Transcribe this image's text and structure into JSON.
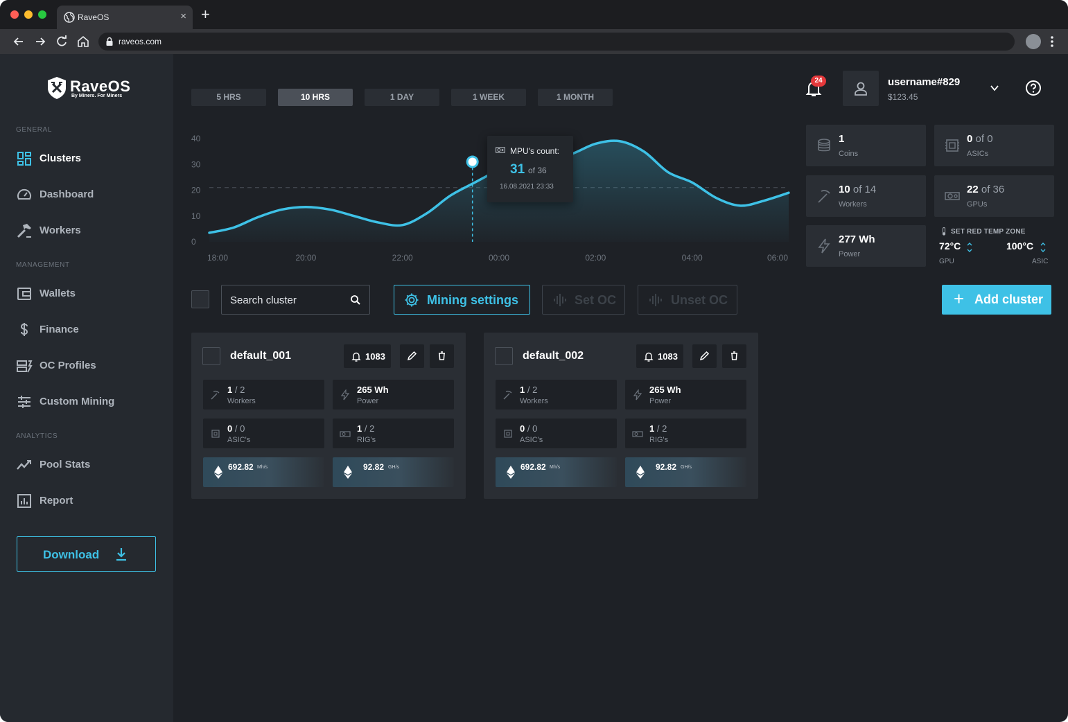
{
  "browser": {
    "tab_title": "RaveOS",
    "tab_close": "×",
    "new_tab": "+",
    "url": "raveos.com"
  },
  "brand": {
    "name": "RaveOS",
    "tagline": "By Miners. For Miners"
  },
  "sidebar": {
    "sections": [
      {
        "label": "GENERAL",
        "items": [
          {
            "label": "Clusters",
            "icon": "grid-icon",
            "active": true
          },
          {
            "label": "Dashboard",
            "icon": "gauge-icon"
          },
          {
            "label": "Workers",
            "icon": "hammer-icon"
          }
        ]
      },
      {
        "label": "MANAGEMENT",
        "items": [
          {
            "label": "Wallets",
            "icon": "wallet-icon"
          },
          {
            "label": "Finance",
            "icon": "dollar-icon"
          },
          {
            "label": "OC Profiles",
            "icon": "oc-icon"
          },
          {
            "label": "Custom Mining",
            "icon": "sliders-icon"
          }
        ]
      },
      {
        "label": "ANALYTICS",
        "items": [
          {
            "label": "Pool Stats",
            "icon": "trend-icon"
          },
          {
            "label": "Report",
            "icon": "report-icon"
          }
        ]
      }
    ],
    "download_label": "Download"
  },
  "range_tabs": [
    {
      "label": "5 HRS",
      "active": false
    },
    {
      "label": "10 HRS",
      "active": true
    },
    {
      "label": "1 DAY",
      "active": false
    },
    {
      "label": "1 WEEK",
      "active": false
    },
    {
      "label": "1 MONTH",
      "active": false
    }
  ],
  "chart_data": {
    "type": "area",
    "x_ticks": [
      "18:00",
      "20:00",
      "22:00",
      "00:00",
      "02:00",
      "04:00",
      "06:00"
    ],
    "y_ticks": [
      0,
      10,
      20,
      30,
      40
    ],
    "ylim": [
      0,
      40
    ],
    "xlim": [
      0,
      12
    ],
    "threshold": 21,
    "x": [
      0,
      0.5,
      1,
      1.5,
      2,
      2.5,
      3,
      3.5,
      4,
      4.5,
      5,
      5.5,
      6,
      6.5,
      7,
      7.5,
      8,
      8.5,
      9,
      9.5,
      10,
      10.5,
      11,
      11.5,
      12
    ],
    "y": [
      3.5,
      5.5,
      9.5,
      12.5,
      13.5,
      12.5,
      10,
      7.5,
      6.5,
      11,
      18,
      23,
      28,
      33,
      32,
      34,
      38,
      39,
      35,
      27,
      23,
      17,
      14,
      16,
      19
    ],
    "highlight": {
      "x": 5.45,
      "y": 31
    },
    "grid": false,
    "color": "#3ec1e6"
  },
  "tooltip": {
    "title": "MPU's count:",
    "value": "31",
    "of": "of 36",
    "date": "16.08.2021 23:33"
  },
  "header": {
    "notifications": "24",
    "username": "username#829",
    "balance": "$123.45"
  },
  "stats": {
    "coins": {
      "value": "1",
      "label": "Coins"
    },
    "asics": {
      "value": "0",
      "of": " of 0",
      "label": "ASICs"
    },
    "workers": {
      "value": "10",
      "of": " of 14",
      "label": "Workers"
    },
    "gpus": {
      "value": "22",
      "of": " of 36",
      "label": "GPUs"
    },
    "power": {
      "value": "277 Wh",
      "label": "Power"
    }
  },
  "temp_zone": {
    "title": "SET RED TEMP ZONE",
    "gpu_value": "72°C",
    "gpu_label": "GPU",
    "asic_value": "100°C",
    "asic_label": "ASIC"
  },
  "actions": {
    "search_placeholder": "Search cluster",
    "mining_settings": "Mining settings",
    "set_oc": "Set OC",
    "unset_oc": "Unset OC",
    "add_cluster": "Add cluster"
  },
  "clusters": [
    {
      "name": "default_001",
      "alerts": "1083",
      "workers": {
        "value": "1",
        "of": " / 2",
        "label": "Workers"
      },
      "power": {
        "value": "265 Wh",
        "label": "Power"
      },
      "asics": {
        "value": "0",
        "of": " / 0",
        "label": "ASIC's"
      },
      "rigs": {
        "value": "1",
        "of": " / 2",
        "label": "RIG's"
      },
      "hash1": {
        "value": "692.82",
        "unit": "Mh/s"
      },
      "hash2": {
        "value": "92.82",
        "unit": "GH/s"
      }
    },
    {
      "name": "default_002",
      "alerts": "1083",
      "workers": {
        "value": "1",
        "of": " / 2",
        "label": "Workers"
      },
      "power": {
        "value": "265 Wh",
        "label": "Power"
      },
      "asics": {
        "value": "0",
        "of": " / 0",
        "label": "ASIC's"
      },
      "rigs": {
        "value": "1",
        "of": " / 2",
        "label": "RIG's"
      },
      "hash1": {
        "value": "692.82",
        "unit": "Mh/s"
      },
      "hash2": {
        "value": "92.82",
        "unit": "GH/s"
      }
    }
  ]
}
